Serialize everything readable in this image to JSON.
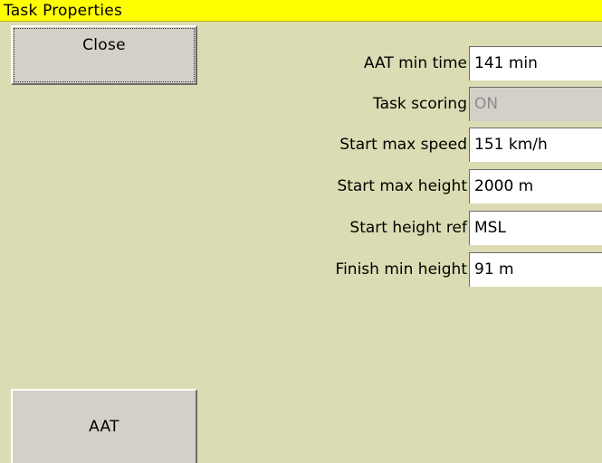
{
  "window": {
    "title": "Task Properties"
  },
  "buttons": {
    "close_label": "Close",
    "aat_label": "AAT"
  },
  "fields": [
    {
      "label": "AAT min time",
      "value": "141 min",
      "disabled": false
    },
    {
      "label": "Task scoring",
      "value": "ON",
      "disabled": true
    },
    {
      "label": "Start max speed",
      "value": "151 km/h",
      "disabled": false
    },
    {
      "label": "Start max height",
      "value": "2000 m",
      "disabled": false
    },
    {
      "label": "Start height ref",
      "value": "MSL",
      "disabled": false
    },
    {
      "label": "Finish min height",
      "value": "91 m",
      "disabled": false
    }
  ],
  "colors": {
    "background": "#dcdcb4",
    "title_bar": "#ffff00",
    "button_face": "#d4d0c8",
    "field_bg": "#ffffff",
    "disabled_text": "#8c8c8c"
  }
}
